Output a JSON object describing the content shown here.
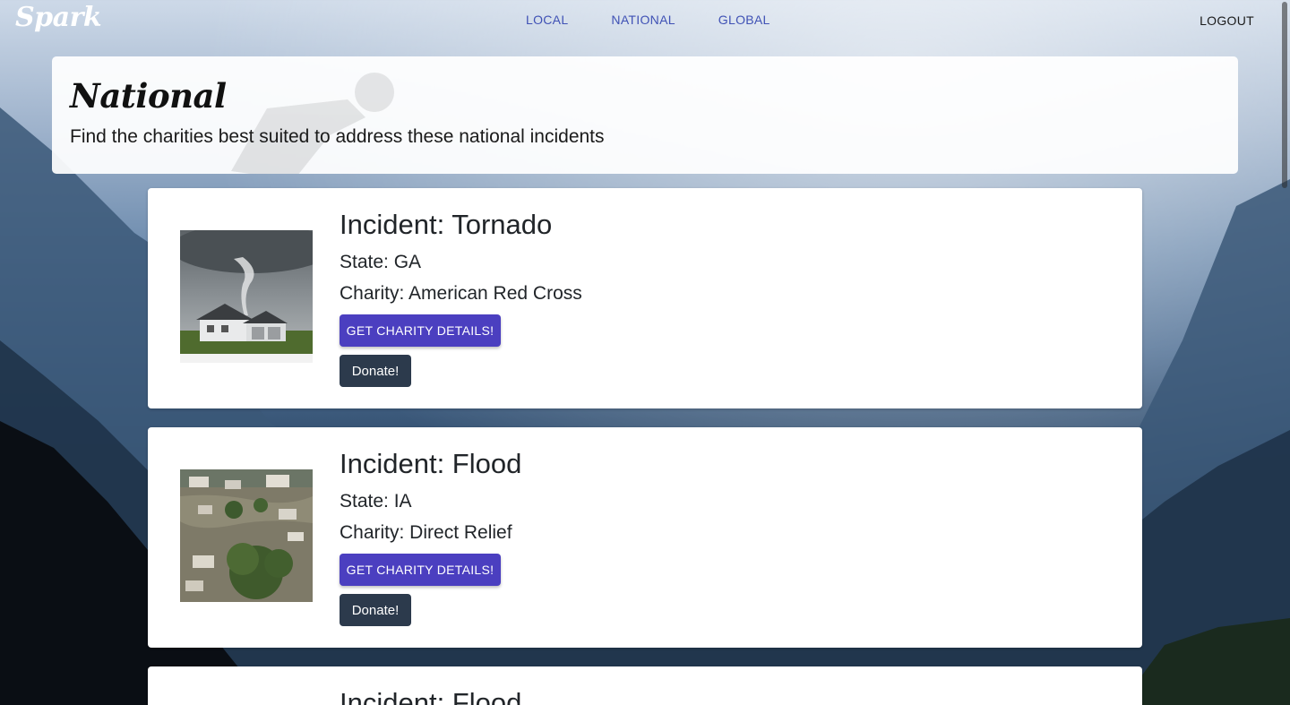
{
  "navbar": {
    "brand": "Spark",
    "links": [
      {
        "label": "LOCAL"
      },
      {
        "label": "NATIONAL"
      },
      {
        "label": "GLOBAL"
      }
    ],
    "logout_label": "LOGOUT"
  },
  "header": {
    "title": "National",
    "subtitle": "Find the charities best suited to address these national incidents"
  },
  "incidents": [
    {
      "title": "Incident: Tornado",
      "state": "State: GA",
      "charity": "Charity: American Red Cross",
      "details_label": "GET CHARITY DETAILS!",
      "donate_label": "Donate!",
      "image_icon": "tornado-photo"
    },
    {
      "title": "Incident: Flood",
      "state": "State: IA",
      "charity": "Charity: Direct Relief",
      "details_label": "GET CHARITY DETAILS!",
      "donate_label": "Donate!",
      "image_icon": "flood-photo"
    },
    {
      "title": "Incident: Flood"
    }
  ],
  "colors": {
    "nav_link": "#3f51b5",
    "details_button": "#4b3fc0",
    "donate_button": "#2c3a4c"
  }
}
